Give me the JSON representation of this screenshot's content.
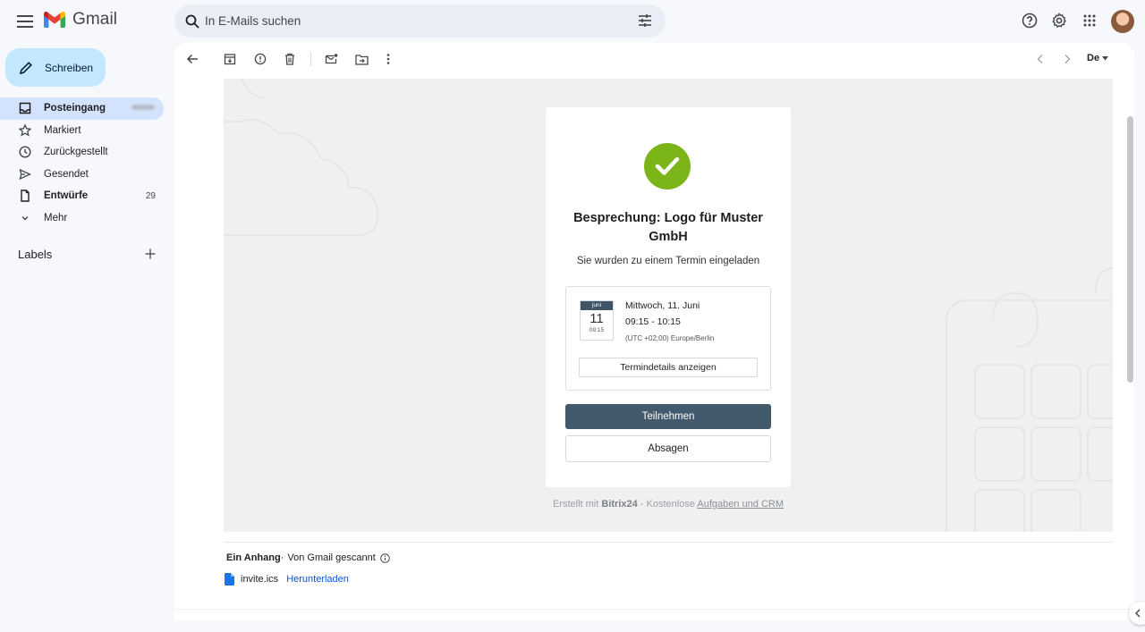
{
  "app": {
    "name": "Gmail"
  },
  "search": {
    "placeholder": "In E-Mails suchen"
  },
  "compose": {
    "label": "Schreiben"
  },
  "nav": {
    "items": [
      {
        "label": "Posteingang",
        "icon": "inbox-icon",
        "active": true,
        "bold": true,
        "count": ""
      },
      {
        "label": "Markiert",
        "icon": "star-icon",
        "count": ""
      },
      {
        "label": "Zurückgestellt",
        "icon": "clock-icon",
        "count": ""
      },
      {
        "label": "Gesendet",
        "icon": "send-icon",
        "count": ""
      },
      {
        "label": "Entwürfe",
        "icon": "draft-icon",
        "bold": true,
        "count": "29"
      },
      {
        "label": "Mehr",
        "icon": "chevron-down-icon",
        "count": ""
      }
    ]
  },
  "labels": {
    "title": "Labels"
  },
  "toolbar": {
    "language": "De"
  },
  "invite": {
    "title": "Besprechung: Logo für Muster GmbH",
    "subtitle": "Sie wurden zu einem Termin eingeladen",
    "calendar": {
      "month": "juni",
      "day": "11",
      "time": "09:15"
    },
    "date": "Mittwoch, 11. Juni",
    "time_range": "09:15 - 10:15",
    "timezone": "(UTC +02:00) Europe/Berlin",
    "details_button": "Termindetails anzeigen",
    "accept_button": "Teilnehmen",
    "decline_button": "Absagen",
    "footer": {
      "prefix": "Erstellt mit ",
      "brand": "Bitrix24",
      "middle": " - Kostenlose ",
      "link": "Aufgaben und CRM"
    }
  },
  "attachments": {
    "heading": "Ein Anhang",
    "scanned": "Von Gmail gescannt",
    "file_name": "invite.ics",
    "download": "Herunterladen"
  },
  "colors": {
    "accent": "#c2e7ff",
    "active_nav": "#d3e3fd",
    "check_green": "#7cb518",
    "accept_button": "#435a6d",
    "link": "#0b57d0"
  }
}
